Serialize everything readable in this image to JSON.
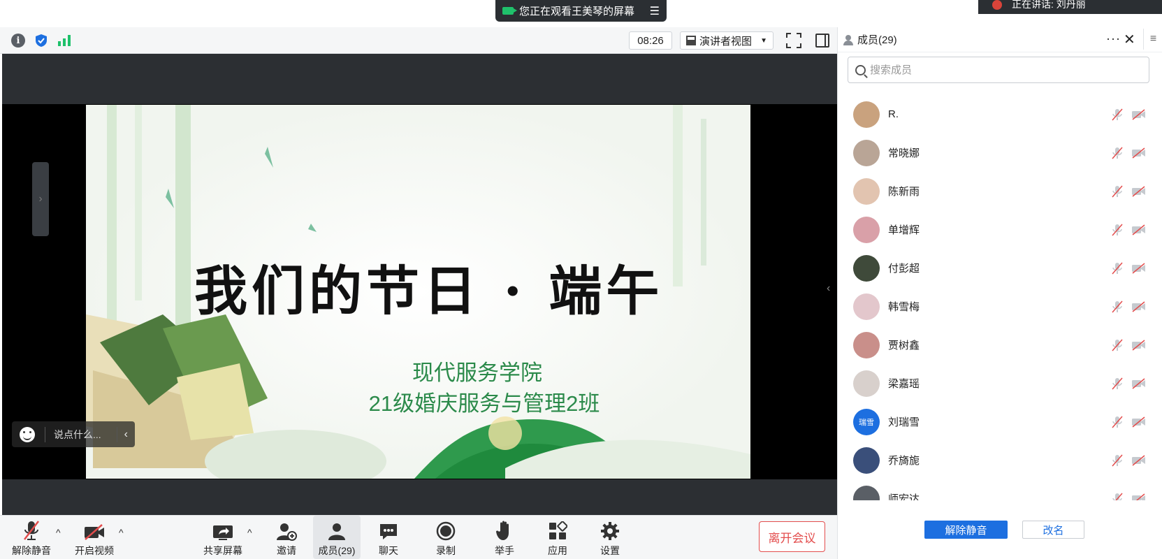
{
  "banner": {
    "text": "您正在观看王美琴的屏幕",
    "menu_glyph": "☰"
  },
  "speaking_popup": {
    "text": "正在讲话: 刘丹丽"
  },
  "toolbar": {
    "info_glyph": "i",
    "timer": "08:26",
    "view_label": "演讲者视图",
    "view_caret": "▼"
  },
  "slide": {
    "title": "我们的节日 · 端午",
    "subtitle_1": "现代服务学院",
    "subtitle_2": "21级婚庆服务与管理2班"
  },
  "chat": {
    "placeholder": "说点什么...",
    "collapse_glyph": "‹"
  },
  "bottom_bar": {
    "unmute": "解除静音",
    "start_video": "开启视频",
    "share_screen": "共享屏幕",
    "invite": "邀请",
    "members": "成员(29)",
    "chat": "聊天",
    "record": "录制",
    "raise_hand": "举手",
    "apps": "应用",
    "settings": "设置",
    "leave": "离开会议",
    "caret": "^"
  },
  "members_panel": {
    "title": "成员(29)",
    "more_glyph": "···",
    "close_glyph": "✕",
    "menu_glyph": "≡",
    "search_placeholder": "搜索成员",
    "members": [
      {
        "name": "R.",
        "avatar_color": "#c9a27e"
      },
      {
        "name": "常晓娜",
        "avatar_color": "#b9a596"
      },
      {
        "name": "陈新雨",
        "avatar_color": "#e2c4b0"
      },
      {
        "name": "单增辉",
        "avatar_color": "#d9a0a8"
      },
      {
        "name": "付彭超",
        "avatar_color": "#3f4a3a"
      },
      {
        "name": "韩雪梅",
        "avatar_color": "#e3c7cc"
      },
      {
        "name": "贾树鑫",
        "avatar_color": "#c98f8a"
      },
      {
        "name": "梁嘉瑶",
        "avatar_color": "#d8d0cc"
      },
      {
        "name": "刘瑞雪",
        "avatar_color": "#1d6fe0",
        "avatar_text": "瑞雪"
      },
      {
        "name": "乔旖旎",
        "avatar_color": "#3a4f7a"
      },
      {
        "name": "师宏达",
        "avatar_color": "#5a5f66"
      }
    ],
    "unmute_all": "解除静音",
    "rename": "改名"
  },
  "window": {
    "controls": "✕"
  },
  "colors": {
    "accent": "#1d6fe0",
    "leave": "#e34d4d",
    "slide_green": "#2b8a4a",
    "muted_icon": "#e34d4d"
  }
}
